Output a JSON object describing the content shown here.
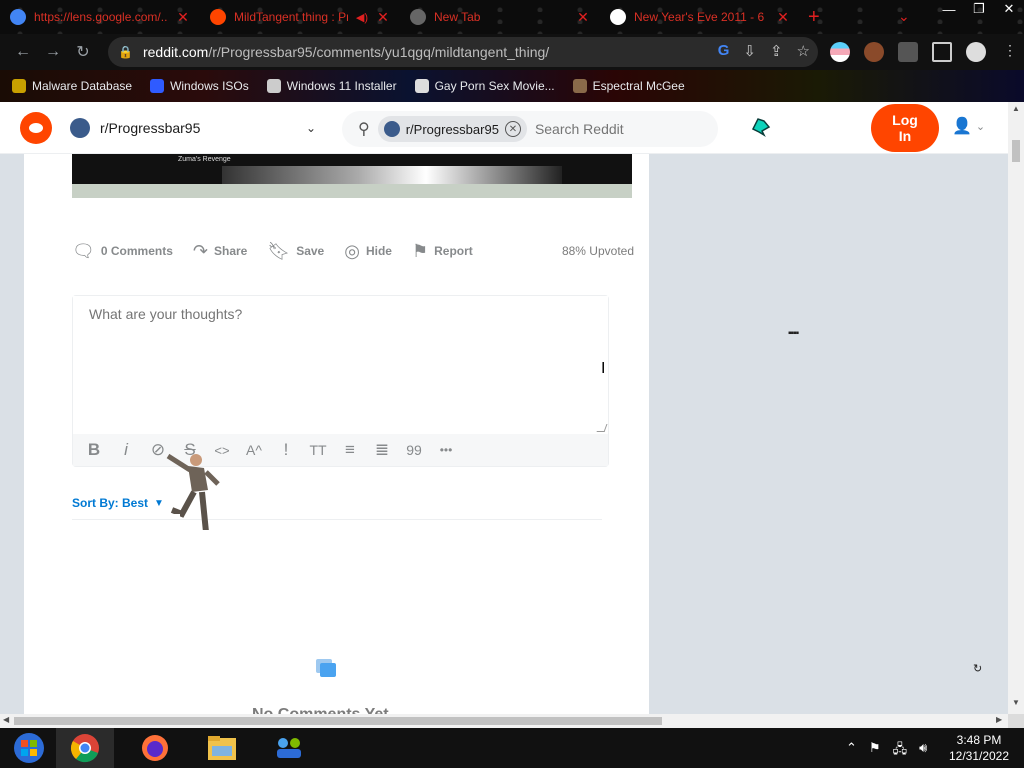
{
  "browser": {
    "tabs": [
      {
        "title": "https://lens.google.com/...",
        "favicon_color": "#4285f4",
        "muted": false
      },
      {
        "title": "MildTangent thing : Pr",
        "favicon_color": "#ff4500",
        "muted": true
      },
      {
        "title": "New Tab",
        "favicon_color": "#666666",
        "muted": false
      },
      {
        "title": "New Year's Eve 2011 - 6",
        "favicon_color": "#ffffff",
        "muted": false
      }
    ],
    "new_tab_label": "+",
    "url_domain": "reddit.com",
    "url_path": "/r/Progressbar95/comments/yu1qgq/mildtangent_thing/",
    "bookmarks": [
      {
        "label": "Malware Database",
        "color": "#c8a000"
      },
      {
        "label": "Windows ISOs",
        "color": "#2f5bff"
      },
      {
        "label": "Windows 11 Installer",
        "color": "#cccccc"
      },
      {
        "label": "Gay Porn Sex Movie...",
        "color": "#dddddd"
      },
      {
        "label": "Espectral McGee",
        "color": "#8a6a4a"
      }
    ]
  },
  "reddit": {
    "community": "r/Progressbar95",
    "search_chip": "r/Progressbar95",
    "search_placeholder": "Search Reddit",
    "login_label_1": "Log",
    "login_label_2": "In"
  },
  "post": {
    "image_title": "Zuma's Revenge",
    "actions": {
      "comments": "0 Comments",
      "share": "Share",
      "save": "Save",
      "hide": "Hide",
      "report": "Report"
    },
    "upvoted": "88% Upvoted",
    "comment_placeholder": "What are your thoughts?",
    "format_buttons": [
      "B",
      "i",
      "⊘",
      "S",
      "<>",
      "A^",
      "!",
      "TT",
      "≡",
      "≣",
      "99",
      "•••"
    ],
    "sort_label": "Sort By: Best",
    "no_comments": "No Comments Yet"
  },
  "taskbar": {
    "time": "3:48 PM",
    "date": "12/31/2022"
  },
  "colors": {
    "reddit_orange": "#ff4500",
    "link_blue": "#0079d3",
    "tab_red": "#e02020"
  }
}
